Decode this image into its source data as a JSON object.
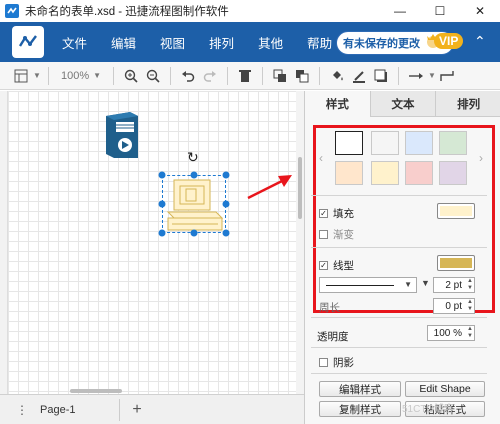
{
  "window": {
    "title": "未命名的表单.xsd - 迅捷流程图制作软件",
    "minimize": "—",
    "maximize": "☐",
    "close": "✕"
  },
  "menu": {
    "items": [
      "文件",
      "编辑",
      "视图",
      "排列",
      "其他",
      "帮助"
    ],
    "unsaved_notice": "有未保存的更改",
    "vip_label": "VIP",
    "collapse_glyph": "⌃"
  },
  "toolbar": {
    "zoom_value": "100%"
  },
  "canvas": {
    "rotate_glyph": "↻"
  },
  "pages": {
    "menu_glyph": "⋮",
    "page_tab": "Page-1",
    "add_glyph": "+"
  },
  "panel": {
    "tabs": [
      "样式",
      "文本",
      "排列"
    ],
    "nav_left": "‹",
    "nav_right": "›",
    "fill_label": "填充",
    "gradient_label": "渐变",
    "line_label": "线型",
    "line_width": "2 pt",
    "perimeter_label": "周长",
    "perimeter_value": "0 pt",
    "opacity_label": "透明度",
    "opacity_value": "100 %",
    "shadow_label": "阴影",
    "edit_style": "编辑样式",
    "edit_shape": "Edit Shape",
    "copy_style": "复制样式",
    "paste_style": "粘贴样式",
    "swatches": [
      "#ffffff",
      "#f5f5f5",
      "#dae8fc",
      "#d5e8d4",
      "#ffe6cc",
      "#fff2cc",
      "#f8cecc",
      "#e1d5e7"
    ],
    "fill_color": "#fff2cc",
    "line_color": "#d6b656"
  },
  "colors": {
    "menubar": "#1d5fa8",
    "highlight": "#e8151c",
    "annotation_arrow": "#e8151c"
  },
  "watermark": "51CTO博客"
}
